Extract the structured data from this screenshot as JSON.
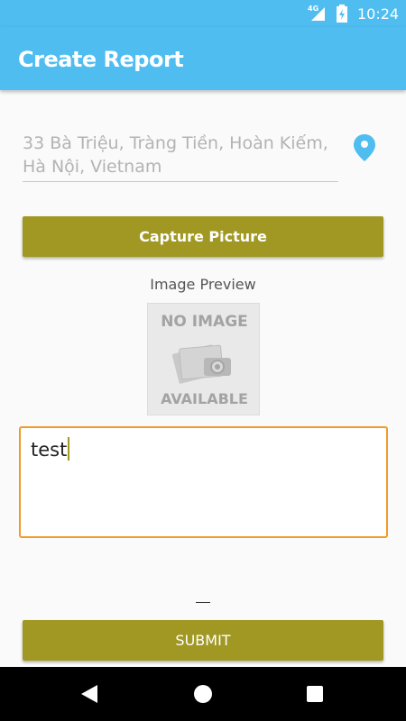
{
  "status_bar": {
    "network": "4G",
    "time": "10:24",
    "icons": [
      "signal-icon",
      "battery-charging-icon"
    ]
  },
  "app_bar": {
    "title": "Create Report"
  },
  "form": {
    "address_value": "33 Bà Triệu, Tràng Tiền, Hoàn Kiếm, Hà Nội, Vietnam",
    "location_icon": "location-pin-icon",
    "capture_label": "Capture Picture",
    "preview_label": "Image Preview",
    "no_image": {
      "line1": "NO IMAGE",
      "line2": "AVAILABLE"
    },
    "description_value": "test",
    "dash": "—",
    "submit_label": "SUBMIT"
  },
  "nav_bar": {
    "icons": [
      "back-icon",
      "home-icon",
      "recents-icon"
    ]
  },
  "colors": {
    "primary": "#4fbdf0",
    "button": "#a19824",
    "focus_border": "#f39a26",
    "hint_text": "#b3b3b3"
  }
}
